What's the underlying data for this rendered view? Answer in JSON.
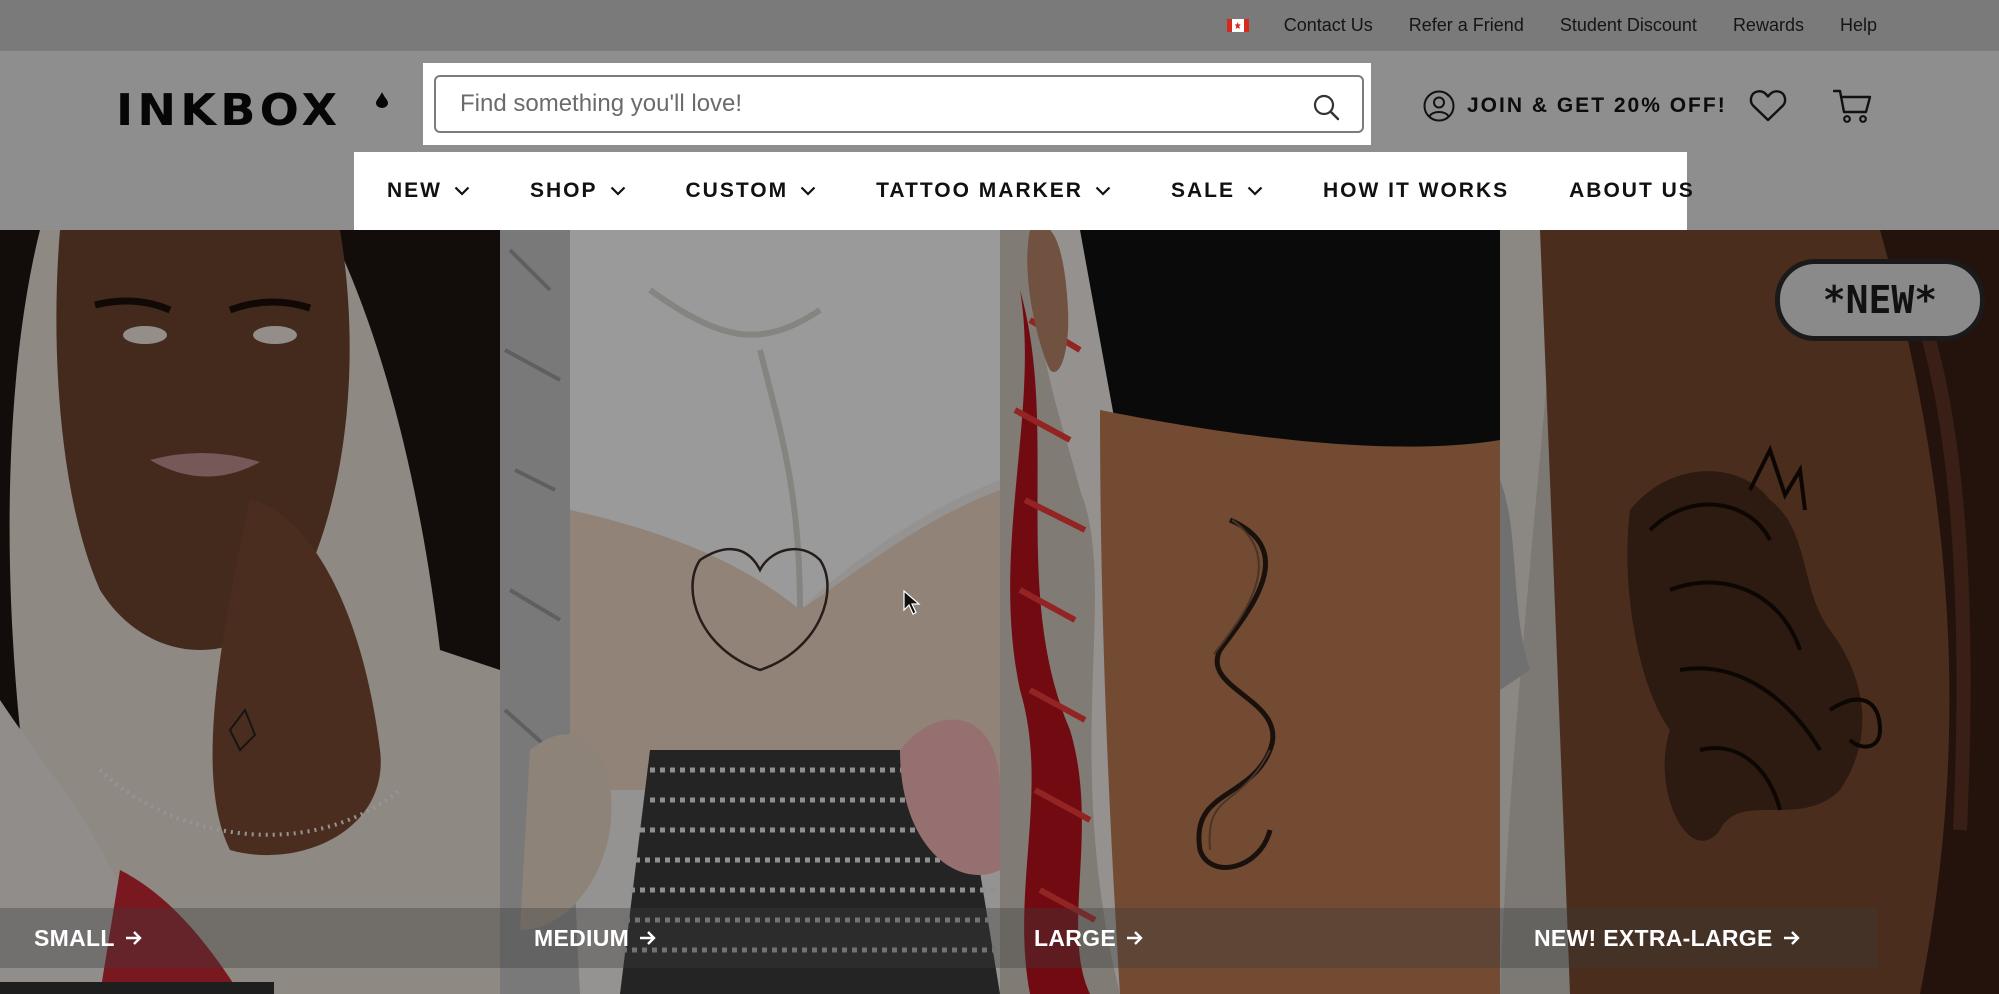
{
  "utility_bar": {
    "flag_icon": "canada-flag-icon",
    "links": [
      "Contact Us",
      "Refer a Friend",
      "Student Discount",
      "Rewards",
      "Help"
    ]
  },
  "header": {
    "logo_text": "INKBOX",
    "search": {
      "placeholder": "Find something you'll love!",
      "value": "",
      "button_icon": "search-icon"
    },
    "account_label": "JOIN & GET 20% OFF!",
    "account_icon": "user-circle-icon",
    "wishlist_icon": "heart-icon",
    "cart_icon": "cart-icon"
  },
  "nav": {
    "items": [
      {
        "label": "NEW",
        "has_dropdown": true
      },
      {
        "label": "SHOP",
        "has_dropdown": true
      },
      {
        "label": "CUSTOM",
        "has_dropdown": true
      },
      {
        "label": "TATTOO MARKER",
        "has_dropdown": true
      },
      {
        "label": "SALE",
        "has_dropdown": true
      },
      {
        "label": "HOW IT WORKS",
        "has_dropdown": false
      },
      {
        "label": "ABOUT US",
        "has_dropdown": false
      }
    ]
  },
  "hero": {
    "badge": "*NEW*",
    "panels": [
      {
        "label": "SMALL"
      },
      {
        "label": "MEDIUM"
      },
      {
        "label": "LARGE"
      },
      {
        "label": "NEW! EXTRA-LARGE"
      }
    ]
  },
  "colors": {
    "overlay": "#000000",
    "nav_bg": "#ffffff",
    "flag_red": "#d52b1e"
  }
}
